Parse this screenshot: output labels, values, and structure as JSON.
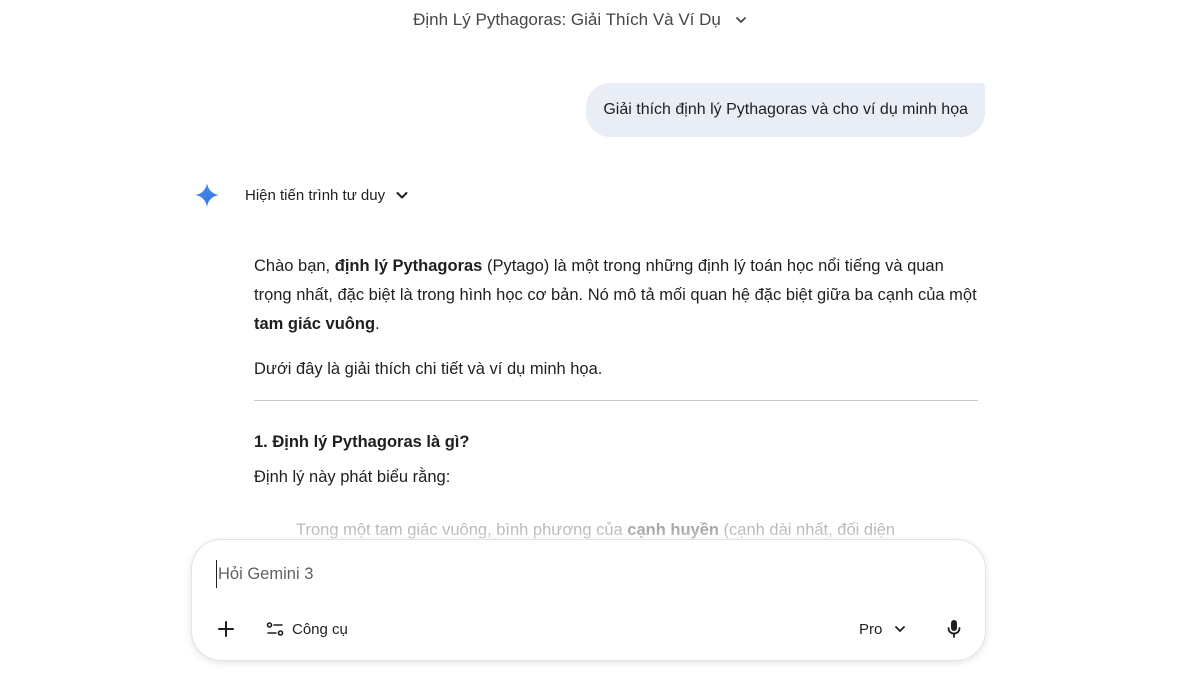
{
  "conversation": {
    "title": "Định Lý Pythagoras: Giải Thích Và Ví Dụ"
  },
  "user_message": {
    "text": "Giải thích định lý Pythagoras và cho ví dụ minh họa"
  },
  "model": {
    "thinking_toggle_label": "Hiện tiến trình tư duy",
    "response": {
      "p1_a": "Chào bạn, ",
      "p1_b": "định lý Pythagoras",
      "p1_c": " (Pytago) là một trong những định lý toán học nổi tiếng và quan trọng nhất, đặc biệt là trong hình học cơ bản. Nó mô tả mối quan hệ đặc biệt giữa ba cạnh của một ",
      "p1_d": "tam giác vuông",
      "p1_e": ".",
      "p2": "Dưới đây là giải thích chi tiết và ví dụ minh họa.",
      "section1_heading": "1. Định lý Pythagoras là gì?",
      "section1_intro": "Định lý này phát biểu rằng:",
      "quote_a": "Trong một tam giác vuông, bình phương của ",
      "quote_b": "cạnh huyền",
      "quote_c": " (cạnh dài nhất, đối diện"
    }
  },
  "composer": {
    "placeholder": "Hỏi Gemini 3",
    "tools_label": "Công cụ",
    "model_label": "Pro"
  },
  "colors": {
    "accent_spark": "#4285f4",
    "bubble_bg": "#e9eef6"
  },
  "icons": {
    "title_dropdown": "chevron-down-icon",
    "spark": "gemini-spark-icon",
    "thinking_expand": "chevron-down-icon",
    "add": "plus-icon",
    "tools": "tools-icon",
    "model_dropdown": "chevron-down-icon",
    "mic": "microphone-icon"
  }
}
